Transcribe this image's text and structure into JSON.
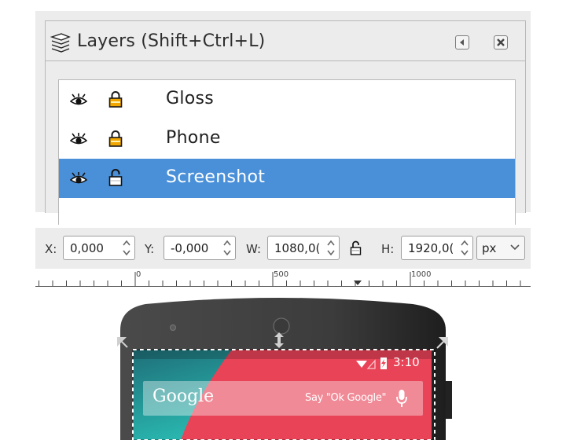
{
  "layers_panel": {
    "title": "Layers (Shift+Ctrl+L)",
    "layers": [
      {
        "name": "Gloss",
        "visible": true,
        "locked": true,
        "selected": false
      },
      {
        "name": "Phone",
        "visible": true,
        "locked": true,
        "selected": false
      },
      {
        "name": "Screenshot",
        "visible": true,
        "locked": false,
        "selected": true
      }
    ],
    "selection_color": "#4a90d9"
  },
  "toolbar": {
    "x_label": "X:",
    "x_value": "0,000",
    "y_label": "Y:",
    "y_value": "-0,000",
    "w_label": "W:",
    "w_value": "1080,0(",
    "h_label": "H:",
    "h_value": "1920,0(",
    "unit": "px"
  },
  "ruler": {
    "labels": [
      "0",
      "500",
      "1000"
    ]
  },
  "canvas": {
    "status_time": "3:10",
    "search_brand": "Google",
    "search_hint": "Say \"Ok Google\""
  }
}
